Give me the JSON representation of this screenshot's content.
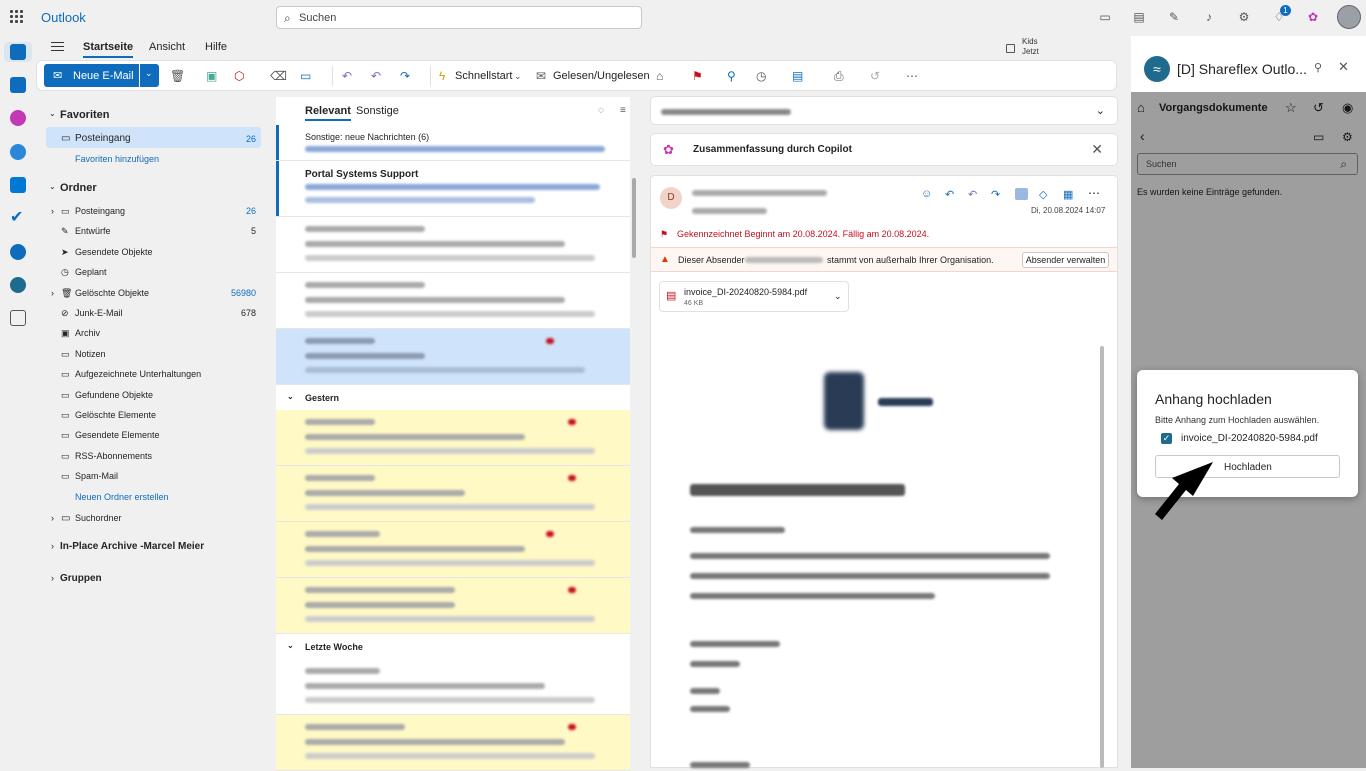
{
  "app": {
    "name": "Outlook"
  },
  "search": {
    "placeholder": "Suchen"
  },
  "header": {
    "notification_count": "1"
  },
  "ribbon_tabs": [
    "Startseite",
    "Ansicht",
    "Hilfe"
  ],
  "kids": {
    "title": "Kids",
    "time": "Jetzt"
  },
  "toolbar": {
    "new_mail": "Neue E-Mail",
    "quickstart": "Schnellstart",
    "read_unread": "Gelesen/Ungelesen"
  },
  "nav": {
    "favorites_title": "Favoriten",
    "favorites": [
      {
        "label": "Posteingang",
        "count": "26"
      }
    ],
    "add_favorite": "Favoriten hinzufügen",
    "folders_title": "Ordner",
    "folders": [
      {
        "label": "Posteingang",
        "count": "26",
        "icon": "inbox-icon",
        "expand": true
      },
      {
        "label": "Entwürfe",
        "count": "5",
        "icon": "pencil-icon",
        "expand": false
      },
      {
        "label": "Gesendete Objekte",
        "count": "",
        "icon": "send-icon",
        "expand": false
      },
      {
        "label": "Geplant",
        "count": "",
        "icon": "clock-icon",
        "expand": false
      },
      {
        "label": "Gelöschte Objekte",
        "count": "56980",
        "icon": "trash-icon",
        "expand": true
      },
      {
        "label": "Junk-E-Mail",
        "count": "678",
        "icon": "junk-icon",
        "expand": false
      },
      {
        "label": "Archiv",
        "count": "",
        "icon": "archive-icon",
        "expand": false
      },
      {
        "label": "Notizen",
        "count": "",
        "icon": "folder-icon",
        "expand": false
      },
      {
        "label": "Aufgezeichnete Unterhaltungen",
        "count": "",
        "icon": "folder-icon",
        "expand": false
      },
      {
        "label": "Gefundene Objekte",
        "count": "",
        "icon": "folder-icon",
        "expand": false
      },
      {
        "label": "Gelöschte Elemente",
        "count": "",
        "icon": "folder-icon",
        "expand": false
      },
      {
        "label": "Gesendete Elemente",
        "count": "",
        "icon": "folder-icon",
        "expand": false
      },
      {
        "label": "RSS-Abonnements",
        "count": "",
        "icon": "folder-icon",
        "expand": false
      },
      {
        "label": "Spam-Mail",
        "count": "",
        "icon": "folder-icon",
        "expand": false
      }
    ],
    "new_folder": "Neuen Ordner erstellen",
    "search_folders": "Suchordner",
    "archive": "In-Place Archive -Marcel Meier",
    "groups": "Gruppen"
  },
  "list": {
    "tab_relevant": "Relevant",
    "tab_other": "Sonstige",
    "other_new": "Sonstige: neue Nachrichten (6)",
    "first_sender": "Portal Systems Support",
    "group_yesterday": "Gestern",
    "group_last_week": "Letzte Woche"
  },
  "reading": {
    "copilot_summary": "Zusammenfassung durch Copilot",
    "sender_initial": "D",
    "date": "Di, 20.08.2024 14:07",
    "flag_text": "Gekennzeichnet Beginnt am 20.08.2024. Fällig am 20.08.2024.",
    "warning_prefix": "Dieser Absender",
    "warning_suffix": "stammt von außerhalb Ihrer Organisation.",
    "manage_sender": "Absender verwalten",
    "attachment_name": "invoice_DI-20240820-5984.pdf",
    "attachment_size": "46 KB"
  },
  "addin": {
    "title": "[D] Shareflex Outlo...",
    "section": "Vorgangsdokumente",
    "search_placeholder": "Suchen",
    "empty": "Es wurden keine Einträge gefunden."
  },
  "dialog": {
    "title": "Anhang hochladen",
    "subtitle": "Bitte Anhang zum Hochladen auswählen.",
    "file": "invoice_DI-20240820-5984.pdf",
    "button": "Hochladen"
  },
  "colors": {
    "accent": "#0f6cbd",
    "flag_red": "#c50f1f",
    "highlight_yellow": "#fff9c5",
    "selected_blue": "#cfe4fa"
  }
}
